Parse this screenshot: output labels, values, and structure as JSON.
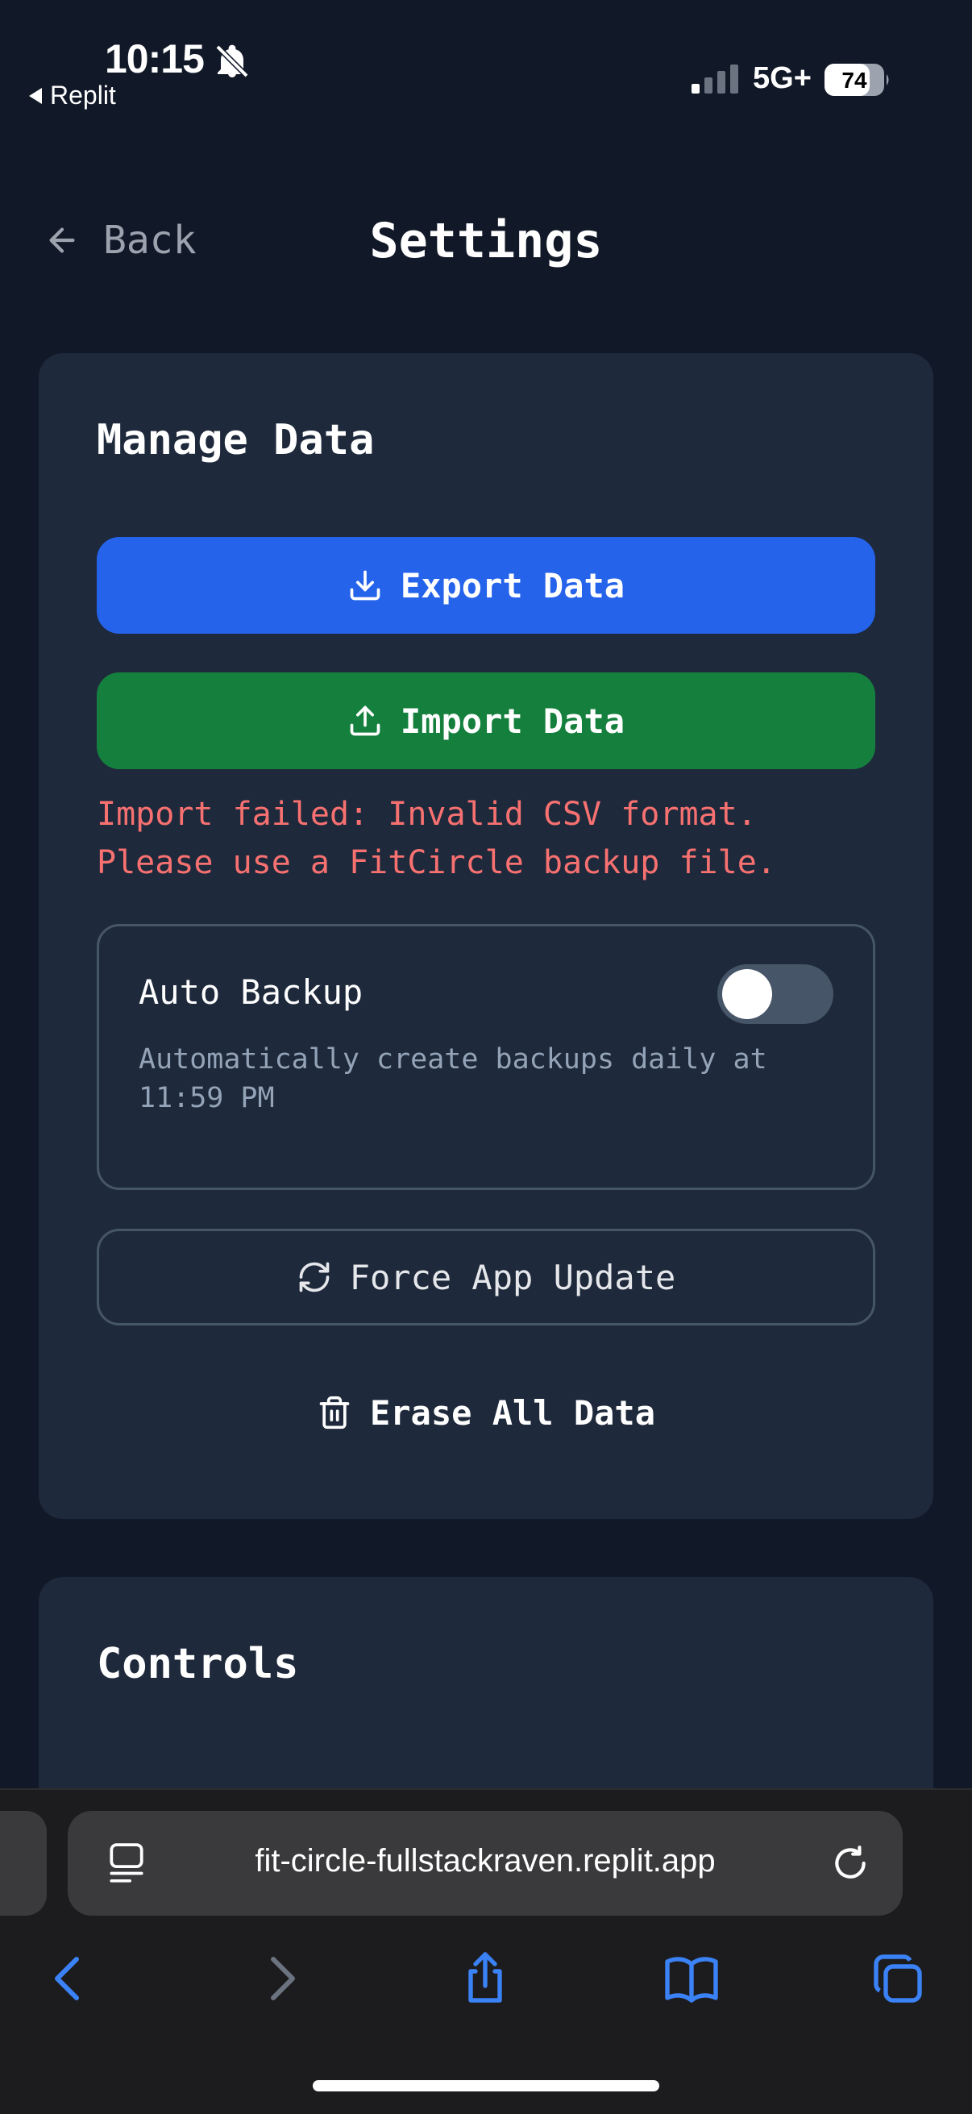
{
  "status_bar": {
    "time": "10:15",
    "back_app": "Replit",
    "network": "5G+",
    "battery": "74"
  },
  "header": {
    "back_label": "Back",
    "title": "Settings"
  },
  "manage_data": {
    "title": "Manage Data",
    "export_label": "Export Data",
    "import_label": "Import Data",
    "error_line1": "Import failed: Invalid CSV format.",
    "error_line2": "Please use a FitCircle backup file.",
    "auto_backup": {
      "label": "Auto Backup",
      "description_line1": "Automatically create backups daily at",
      "description_line2": "11:59 PM",
      "enabled": false
    },
    "force_update_label": "Force App Update",
    "erase_label": "Erase All Data"
  },
  "controls": {
    "title": "Controls"
  },
  "browser": {
    "url": "fit-circle-fullstackraven.replit.app"
  },
  "colors": {
    "background": "#111827",
    "card": "#1e293b",
    "export": "#2563eb",
    "import": "#15803d",
    "error": "#f87171",
    "link": "#3b82f6"
  }
}
